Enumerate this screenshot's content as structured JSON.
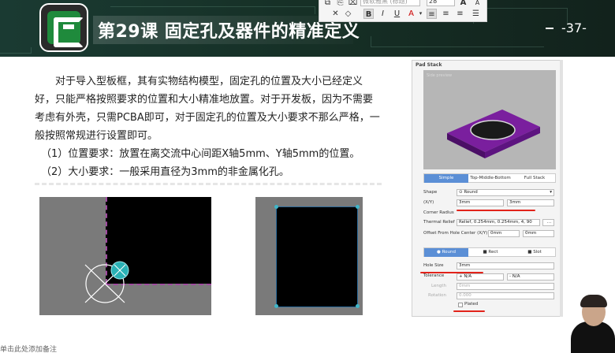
{
  "slide": {
    "title": "第29课 固定孔及器件的精准定义",
    "page_number": "-37-",
    "paragraph": "对于导入型板框，其有实物结构模型，固定孔的位置及大小已经定义好，只能严格按照要求的位置和大小精准地放置。对于开发板，因为不需要考虑有外壳，只需PCBA即可，对于固定孔的位置及大小要求不那么严格，一般按照常规进行设置即可。",
    "items": [
      "（1）位置要求：放置在离交流中心间距X轴5mm、Y轴5mm的位置。",
      "（2）大小要求：一般采用直径为3mm的非金属化孔。"
    ]
  },
  "toolbar": {
    "font_name": "微软雅黑 (标题)",
    "font_size": "28",
    "bold": "B",
    "italic": "I",
    "underline": "U",
    "font_color": "A",
    "grow_font": "A",
    "shrink_font": "A"
  },
  "pad_panel": {
    "title": "Pad Stack",
    "preview_label": "Side preview",
    "layer_tabs": [
      "Simple",
      "Top-Middle-Bottom",
      "Full Stack"
    ],
    "shape_label": "Shape",
    "shape_value": "Round",
    "xy_label": "(X/Y)",
    "x_value": "3mm",
    "y_value": "3mm",
    "corner_radius_label": "Corner Radius",
    "thermal_relief_label": "Thermal Relief",
    "thermal_relief_value": "Relief, 0.254mm, 0.254mm, 4, 90",
    "offset_label": "Offset From Hole Center (X/Y)",
    "offset_x": "0mm",
    "offset_y": "0mm",
    "hole_shape_tabs": [
      "Round",
      "Rect",
      "Slot"
    ],
    "hole_size_label": "Hole Size",
    "hole_size_value": "3mm",
    "tolerance_label": "Tolerance",
    "tolerance_plus": "N/A",
    "tolerance_minus": "N/A",
    "length_label": "Length",
    "length_value": "0mm",
    "rotation_label": "Rotation",
    "rotation_value": "0.000",
    "plated_label": "Plated"
  },
  "footer": {
    "corner_text": "单击此处添加备注"
  },
  "colors": {
    "header_bg": "#163026",
    "accent_green": "#1f8a3c",
    "pad_purple": "#6a1a8a",
    "selected_tab": "#5b8fd6",
    "annotation_red": "#e2231a",
    "via_cyan": "#3fb6c8"
  }
}
